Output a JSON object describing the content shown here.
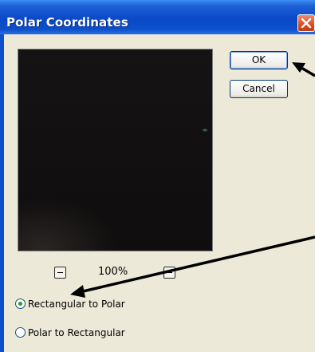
{
  "window": {
    "title": "Polar Coordinates"
  },
  "buttons": {
    "ok_label": "OK",
    "cancel_label": "Cancel"
  },
  "zoom": {
    "level": "100%"
  },
  "options": {
    "selected": "Rectangular to Polar",
    "items": [
      {
        "label": "Rectangular to Polar",
        "selected": true
      },
      {
        "label": "Polar to Rectangular",
        "selected": false
      }
    ]
  },
  "icons": {
    "close": "close-icon",
    "zoom_out": "minus-icon",
    "zoom_in": "plus-icon"
  },
  "colors": {
    "titlebar": "#0a49c7",
    "dialog_bg": "#ece9d8",
    "close": "#dc4b1f",
    "radio_dot": "#21a121",
    "annotation_arrow": "#000000"
  }
}
